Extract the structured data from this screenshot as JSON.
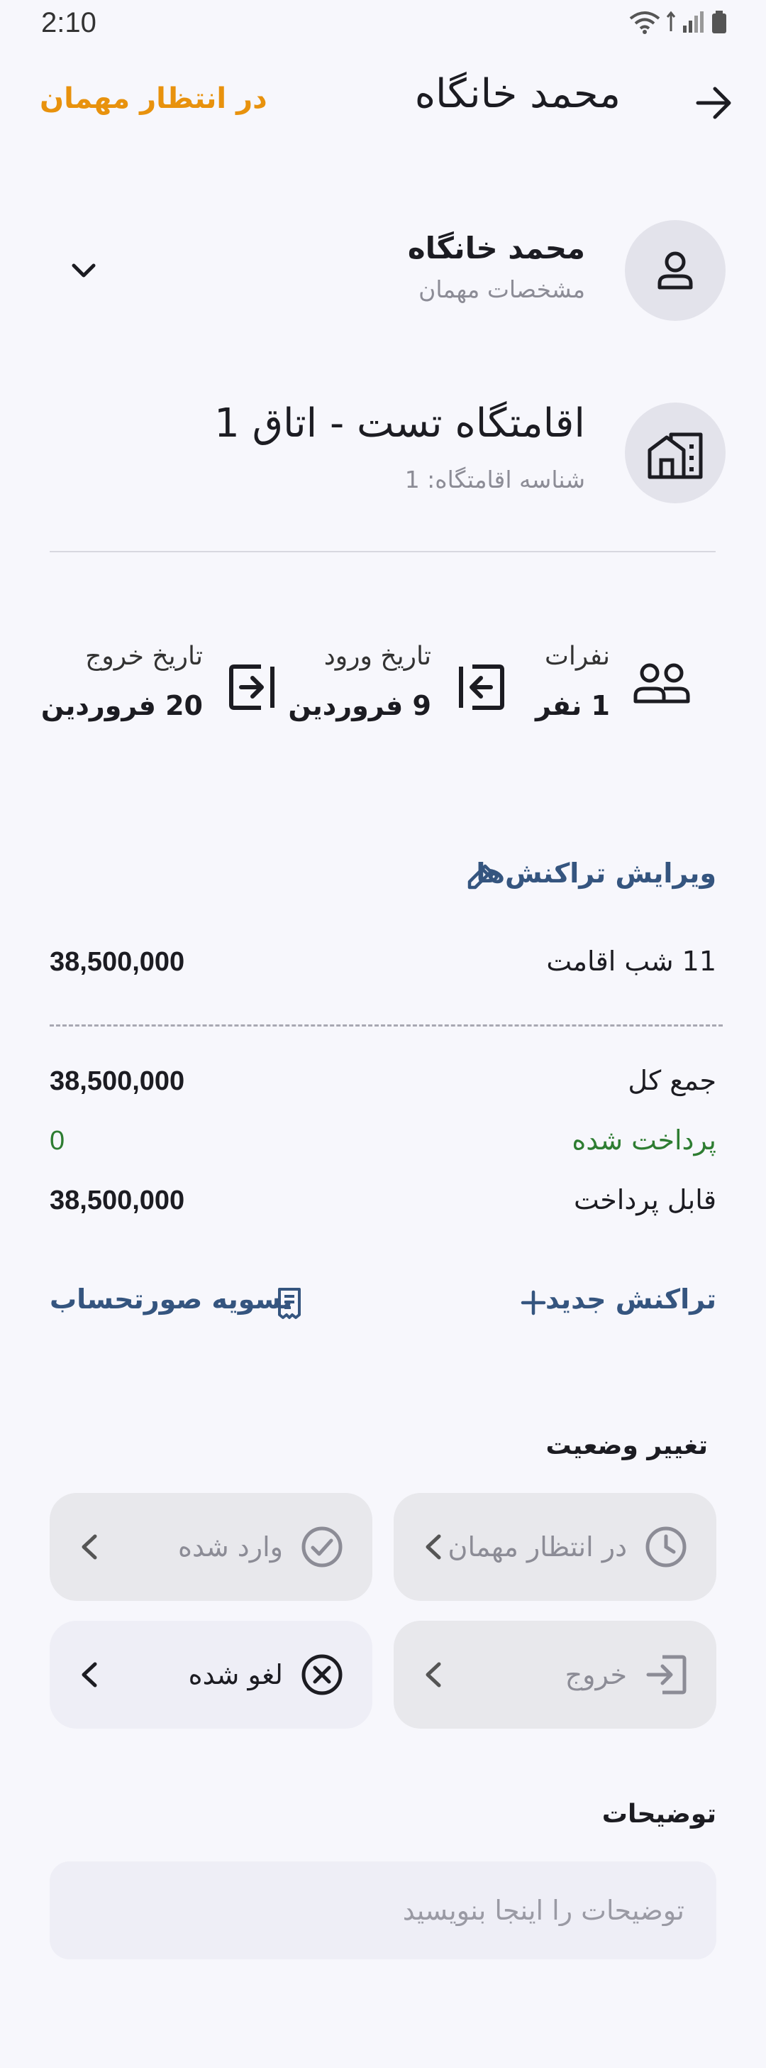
{
  "status_bar": {
    "time": "2:10"
  },
  "header": {
    "title": "محمد خانگاه",
    "status_link": "در انتظار مهمان"
  },
  "guest": {
    "name": "محمد خانگاه",
    "subtitle": "مشخصات مهمان"
  },
  "accommodation": {
    "name": "اقامتگاه تست - اتاق 1",
    "subtitle": "شناسه اقامتگاه: 1"
  },
  "info": {
    "people_label": "نفرات",
    "people_value": "1 نفر",
    "checkin_label": "تاریخ ورود",
    "checkin_value": "9 فروردین",
    "checkout_label": "تاریخ خروج",
    "checkout_value": "20 فروردین"
  },
  "transactions": {
    "edit_label": "ویرایش تراکنش‌ها",
    "stay_label": "11 شب اقامت",
    "stay_value": "38,500,000",
    "total_label": "جمع کل",
    "total_value": "38,500,000",
    "paid_label": "پرداخت شده",
    "paid_value": "0",
    "payable_label": "قابل پرداخت",
    "payable_value": "38,500,000",
    "new_tx_label": "تراکنش جدید",
    "settle_label": "تسویه صورتحساب"
  },
  "status_change": {
    "title": "تغییر وضعیت",
    "options": [
      {
        "label": "در انتظار مهمان",
        "icon": "clock-icon"
      },
      {
        "label": "وارد شده",
        "icon": "check-circle-icon"
      },
      {
        "label": "خروج",
        "icon": "exit-icon"
      },
      {
        "label": "لغو شده",
        "icon": "cancel-circle-icon"
      }
    ]
  },
  "notes": {
    "title": "توضیحات",
    "placeholder": "توضیحات را اینجا بنویسید"
  },
  "colors": {
    "accent_orange": "#E8920D",
    "link_blue": "#35557F",
    "paid_green": "#2E7D32",
    "background": "#F7F7FC"
  }
}
